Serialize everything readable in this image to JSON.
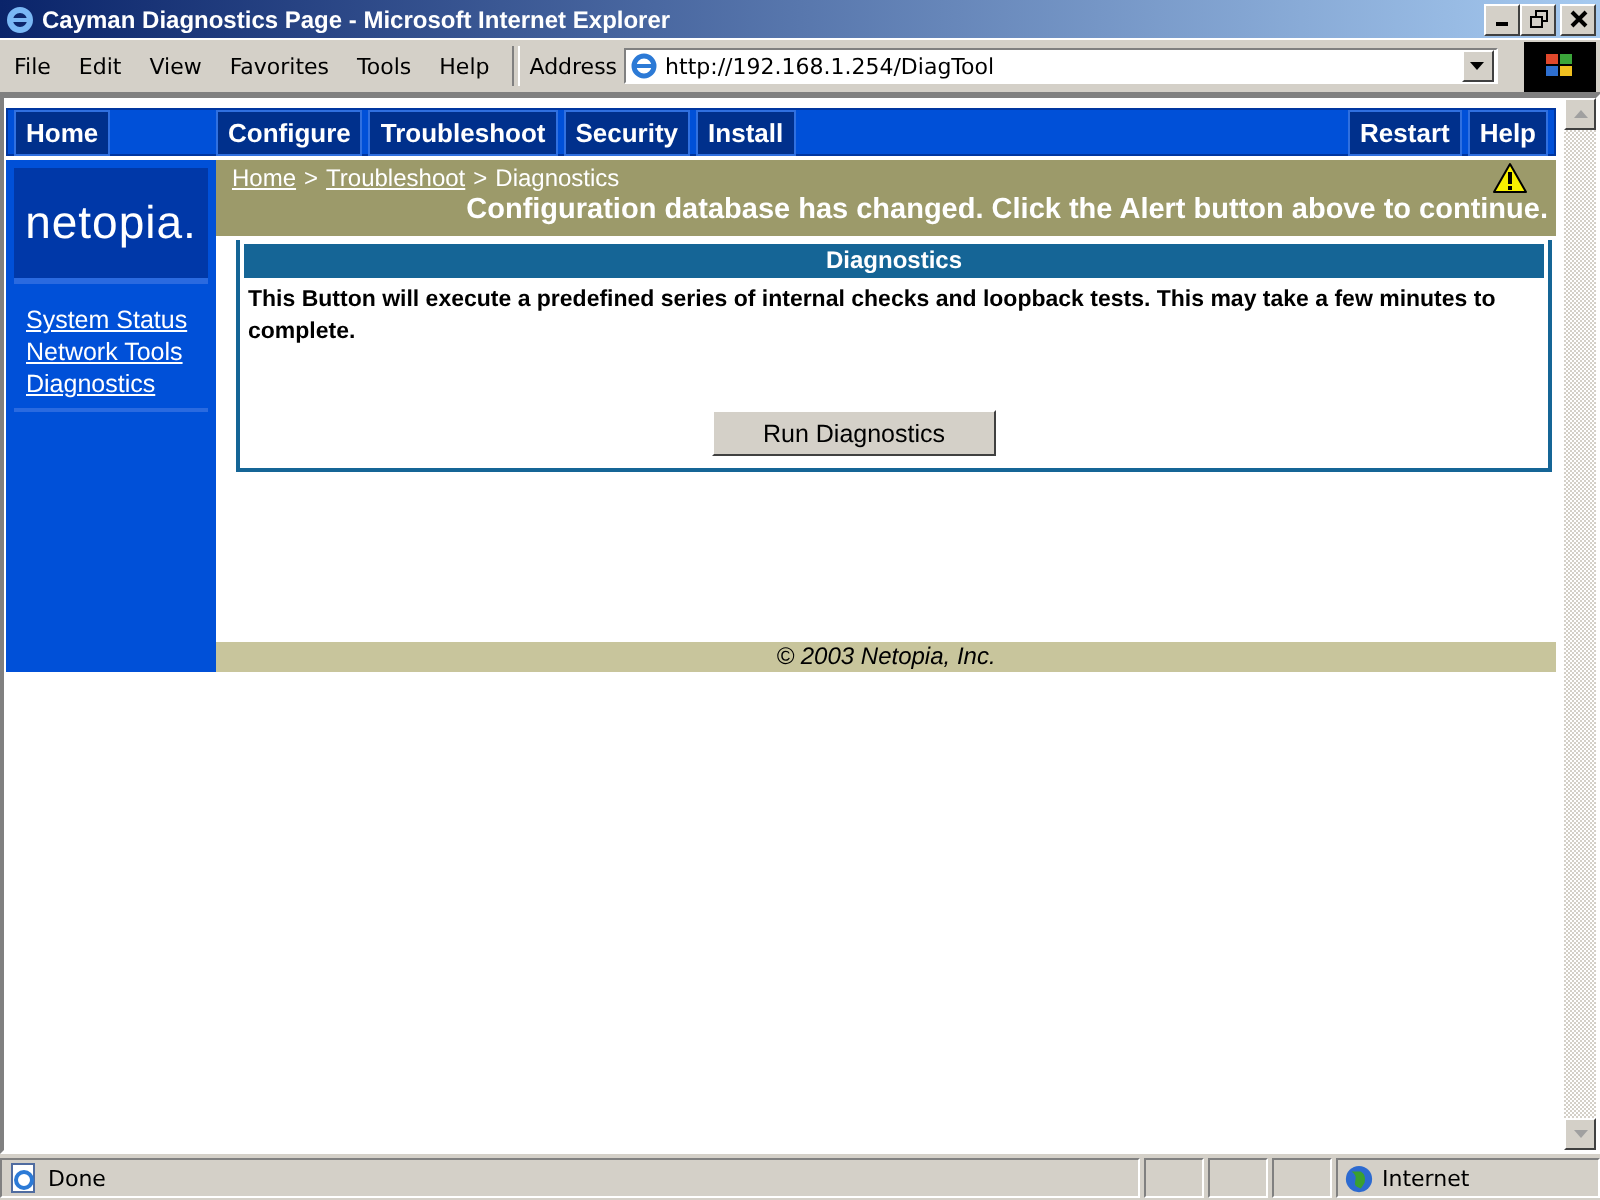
{
  "window": {
    "title": "Cayman Diagnostics Page - Microsoft Internet Explorer"
  },
  "menu": [
    "File",
    "Edit",
    "View",
    "Favorites",
    "Tools",
    "Help"
  ],
  "address": {
    "label": "Address",
    "value": "http://192.168.1.254/DiagTool"
  },
  "nav": {
    "left": [
      "Home"
    ],
    "middle": [
      "Configure",
      "Troubleshoot",
      "Security",
      "Install"
    ],
    "right": [
      "Restart",
      "Help"
    ]
  },
  "logo": "netopia.",
  "sidebar": {
    "items": [
      "System Status",
      "Network Tools",
      "Diagnostics"
    ]
  },
  "breadcrumb": [
    {
      "label": "Home",
      "kind": "link"
    },
    {
      "label": ">",
      "kind": "separator"
    },
    {
      "label": "Troubleshoot",
      "kind": "link"
    },
    {
      "label": ">",
      "kind": "separator"
    },
    {
      "label": "Diagnostics",
      "kind": "current"
    }
  ],
  "alert": "Configuration database has changed. Click the Alert button above to continue.",
  "panel": {
    "title": "Diagnostics",
    "description": "This Button will execute a predefined series of internal checks and loopback tests. This may take a few minutes to complete.",
    "button": "Run Diagnostics"
  },
  "footer": "© 2003 Netopia, Inc.",
  "status_bar": {
    "text": "Done",
    "zone": "Internet"
  }
}
